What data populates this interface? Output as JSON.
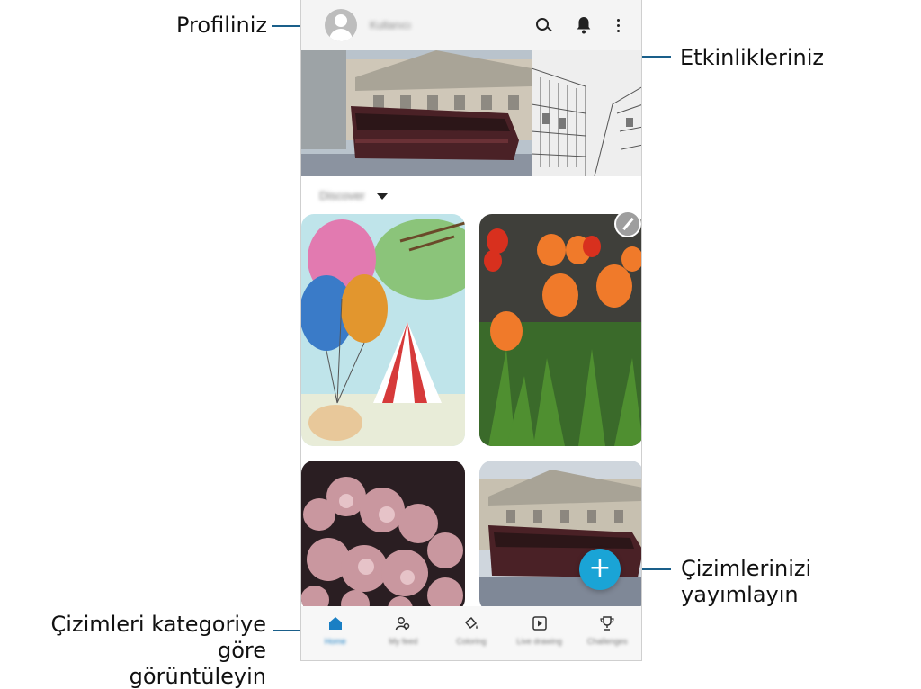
{
  "callouts": {
    "profile": "Profiliniz",
    "activities": "Etkinlikleriniz",
    "publish": "Çizimlerinizi yayımlayın",
    "category_line1": "Çizimleri kategoriye göre",
    "category_line2": "görüntüleyin"
  },
  "appbar": {
    "username": "Kullanıcı",
    "icons": [
      "avatar",
      "search-icon",
      "bell-icon",
      "more-icon"
    ]
  },
  "feed": {
    "section_label": "Discover"
  },
  "fab": {
    "label": "+"
  },
  "bottom_nav": {
    "items": [
      {
        "label": "Home",
        "icon": "home-icon",
        "active": true
      },
      {
        "label": "My feed",
        "icon": "people-icon",
        "active": false
      },
      {
        "label": "Coloring",
        "icon": "paint-bucket-icon",
        "active": false
      },
      {
        "label": "Live drawing",
        "icon": "play-icon",
        "active": false
      },
      {
        "label": "Challenges",
        "icon": "trophy-icon",
        "active": false
      }
    ]
  },
  "colors": {
    "accent": "#1aa4d6",
    "callout_line": "#1a5f8a",
    "nav_active": "#1a7fc4"
  }
}
